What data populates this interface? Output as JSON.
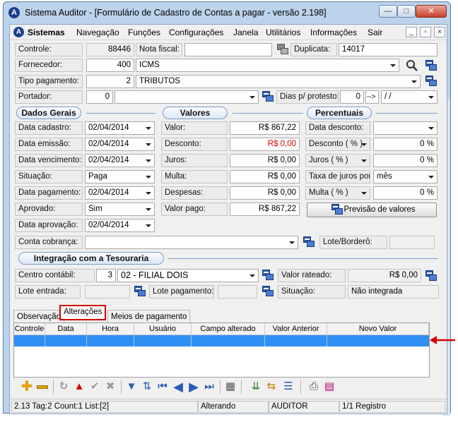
{
  "window": {
    "title": "Sistema Auditor - [Formulário de Cadastro de Contas a pagar - versão 2.198]",
    "min": "—",
    "max": "□",
    "close": "✕",
    "app_glyph": "A"
  },
  "menu": {
    "items": [
      "Sistemas",
      "Navegação",
      "Funções",
      "Configurações",
      "Janela",
      "Utilitários",
      "Informações",
      "Sair"
    ],
    "mdi_min": "_",
    "mdi_max": "▫",
    "mdi_close": "×"
  },
  "form": {
    "controle_label": "Controle:",
    "controle_value": "88446",
    "nota_fiscal_label": "Nota fiscal:",
    "nota_fiscal_value": "",
    "duplicata_label": "Duplicata:",
    "duplicata_value": "14017",
    "fornecedor_label": "Fornecedor:",
    "fornecedor_code": "400",
    "fornecedor_name": "ICMS",
    "tipo_pagamento_label": "Tipo pagamento:",
    "tipo_pagamento_code": "2",
    "tipo_pagamento_name": "TRIBUTOS",
    "portador_label": "Portador:",
    "portador_code": "0",
    "portador_name": "",
    "dias_protesto_label": "Dias p/ protesto:",
    "dias_protesto_value": "0",
    "dias_protesto_btn": "-->",
    "dias_protesto_date": " / /"
  },
  "sections": {
    "dados_gerais": "Dados Gerais",
    "valores": "Valores",
    "percentuais": "Percentuais",
    "tesouraria": "Integração com a Tesouraria"
  },
  "dados_gerais": [
    {
      "label": "Data cadastro:",
      "value": "02/04/2014"
    },
    {
      "label": "Data emissão:",
      "value": "02/04/2014"
    },
    {
      "label": "Data vencimento:",
      "value": "02/04/2014"
    },
    {
      "label": "Situação:",
      "value": "Paga"
    },
    {
      "label": "Data pagamento:",
      "value": "02/04/2014"
    },
    {
      "label": "Aprovado:",
      "value": "Sim"
    },
    {
      "label": "Data aprovação:",
      "value": "02/04/2014"
    }
  ],
  "valores": [
    {
      "label": "Valor:",
      "value": "R$ 867,22"
    },
    {
      "label": "Desconto:",
      "value": "R$ 0,00"
    },
    {
      "label": "Juros:",
      "value": "R$ 0,00"
    },
    {
      "label": "Multa:",
      "value": "R$ 0,00"
    },
    {
      "label": "Despesas:",
      "value": "R$ 0,00"
    },
    {
      "label": "Valor pago:",
      "value": "R$ 867,22"
    }
  ],
  "percentuais": [
    {
      "label": "Data desconto:",
      "value": ""
    },
    {
      "label": "Desconto ( % )",
      "value": "0 %"
    },
    {
      "label": "Juros ( % )",
      "value": "0 %"
    },
    {
      "label": "Taxa de juros por:",
      "value": "mês"
    },
    {
      "label": "Multa ( % )",
      "value": "0 %"
    }
  ],
  "previsao_button": "Previsão de valores",
  "conta_cobranca_label": "Conta cobrança:",
  "conta_cobranca_value": "",
  "lote_bordero_label": "Lote/Borderô:",
  "lote_bordero_value": "",
  "tesouraria": {
    "centro_contabil_label": "Centro contábil:",
    "centro_contabil_code": "3",
    "centro_contabil_name": "02 -  FILIAL DOIS",
    "valor_rateado_label": "Valor rateado:",
    "valor_rateado_value": "R$ 0,00",
    "lote_entrada_label": "Lote entrada:",
    "lote_entrada_value": "",
    "lote_pagamento_label": "Lote pagamento:",
    "lote_pagamento_value": "",
    "situacao_label": "Situação:",
    "situacao_value": "Não integrada"
  },
  "tabs": [
    "Observação",
    "Alterações",
    "Meios de pagamento"
  ],
  "grid": {
    "columns": [
      "Controle",
      "Data",
      "Hora",
      "Usuário",
      "Campo alterado",
      "Valor Anterior",
      "Novo Valor"
    ]
  },
  "statusbar": {
    "left": "2.13 Tag:2 Count:1 List:[2]",
    "mode": "Alterando",
    "user": "AUDITOR",
    "records": "1/1 Registro"
  },
  "accent": {
    "red": "#d60000",
    "selection": "#2f8ff2",
    "section_border": "#7a9cc8"
  }
}
